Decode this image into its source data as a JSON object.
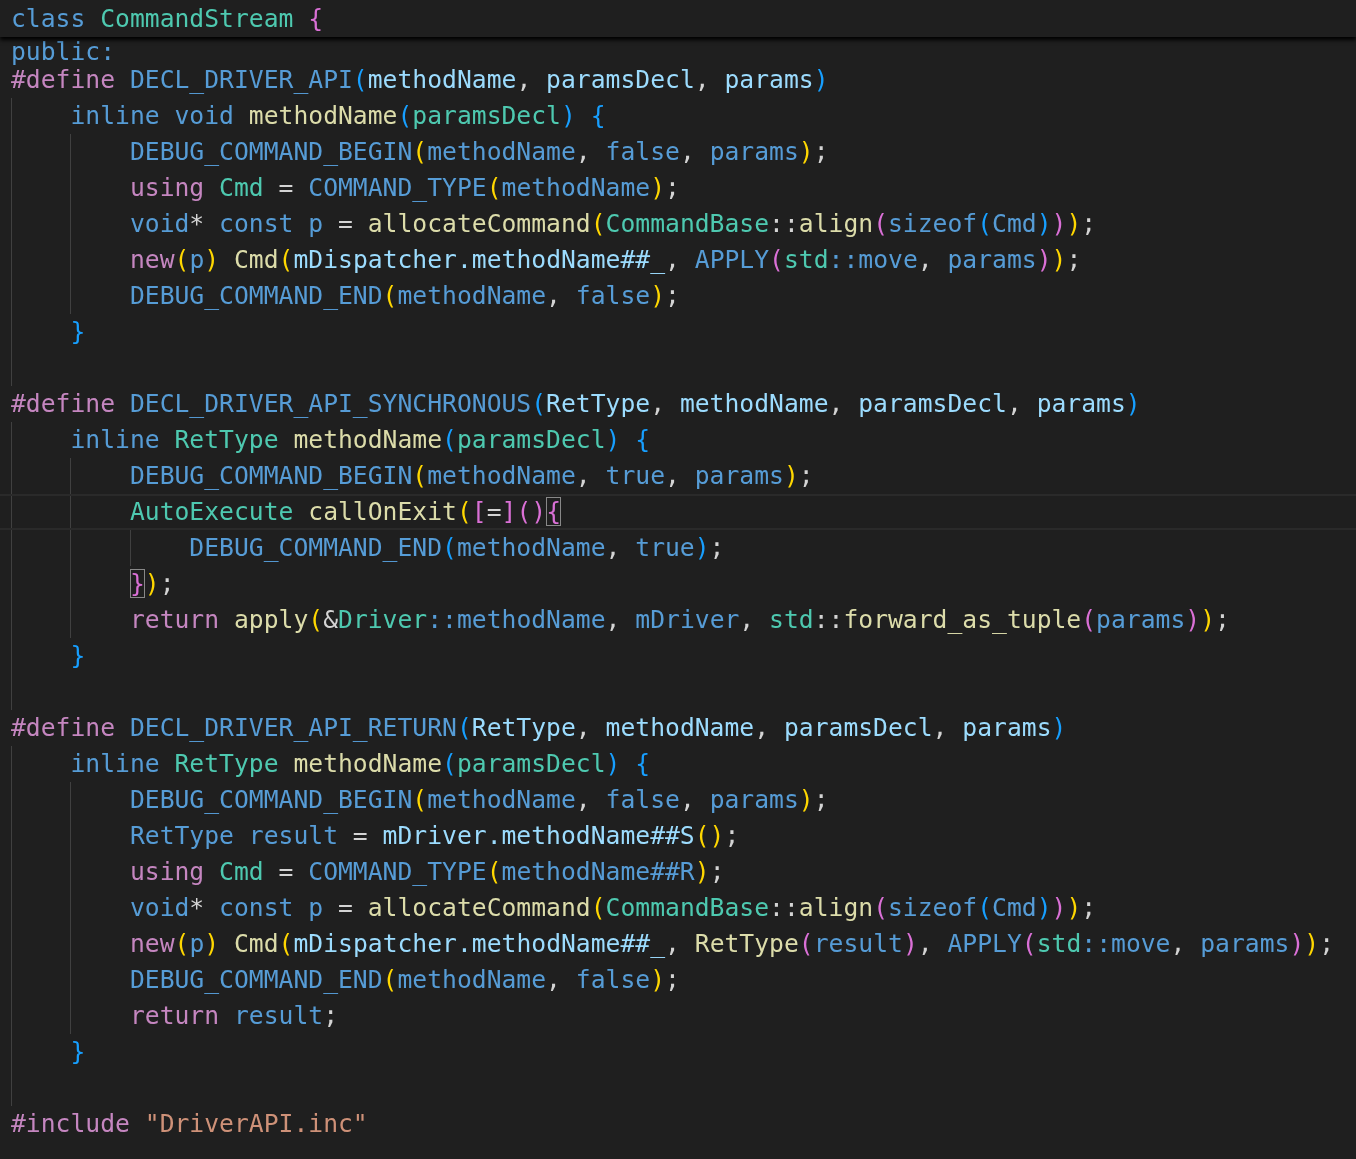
{
  "editor": {
    "sticky_line": {
      "tokens": [
        {
          "text": "class",
          "kind": "kw"
        },
        {
          "text": " CommandStream",
          "kind": "type"
        },
        {
          "text": " {",
          "kind": "b2"
        }
      ]
    },
    "partial_line": {
      "tokens": [
        {
          "text": "public:",
          "kind": "kw"
        }
      ]
    },
    "lines": [
      {
        "kind": "code",
        "tokens": [
          {
            "text": "#define",
            "kind": "ctl"
          },
          {
            "text": " DECL_DRIVER_API",
            "kind": "kw"
          },
          {
            "text": "(",
            "kind": "b3"
          },
          {
            "text": "methodName",
            "kind": "var"
          },
          {
            "text": ", ",
            "kind": "op"
          },
          {
            "text": "paramsDecl",
            "kind": "var"
          },
          {
            "text": ", ",
            "kind": "op"
          },
          {
            "text": "params",
            "kind": "var"
          },
          {
            "text": ")",
            "kind": "b3"
          }
        ]
      },
      {
        "kind": "code",
        "tokens": [
          {
            "text": "    inline void",
            "kind": "kw"
          },
          {
            "text": " methodName",
            "kind": "fn"
          },
          {
            "text": "(",
            "kind": "b3"
          },
          {
            "text": "paramsDecl",
            "kind": "type"
          },
          {
            "text": ")",
            "kind": "b3"
          },
          {
            "text": " {",
            "kind": "b3"
          }
        ]
      },
      {
        "kind": "code",
        "tokens": [
          {
            "text": "        DEBUG_COMMAND_BEGIN",
            "kind": "kw"
          },
          {
            "text": "(",
            "kind": "b1"
          },
          {
            "text": "methodName",
            "kind": "kw"
          },
          {
            "text": ", ",
            "kind": "op"
          },
          {
            "text": "false",
            "kind": "kw"
          },
          {
            "text": ", ",
            "kind": "op"
          },
          {
            "text": "params",
            "kind": "kw"
          },
          {
            "text": ")",
            "kind": "b1"
          },
          {
            "text": ";",
            "kind": "op"
          }
        ]
      },
      {
        "kind": "code",
        "tokens": [
          {
            "text": "        using",
            "kind": "ctl"
          },
          {
            "text": " Cmd",
            "kind": "type"
          },
          {
            "text": " = ",
            "kind": "op"
          },
          {
            "text": "COMMAND_TYPE",
            "kind": "kw"
          },
          {
            "text": "(",
            "kind": "b1"
          },
          {
            "text": "methodName",
            "kind": "kw"
          },
          {
            "text": ")",
            "kind": "b1"
          },
          {
            "text": ";",
            "kind": "op"
          }
        ]
      },
      {
        "kind": "code",
        "tokens": [
          {
            "text": "        void",
            "kind": "kw"
          },
          {
            "text": "* ",
            "kind": "op"
          },
          {
            "text": "const p",
            "kind": "kw"
          },
          {
            "text": " = ",
            "kind": "op"
          },
          {
            "text": "allocateCommand",
            "kind": "fn"
          },
          {
            "text": "(",
            "kind": "b1"
          },
          {
            "text": "CommandBase",
            "kind": "type"
          },
          {
            "text": "::",
            "kind": "op"
          },
          {
            "text": "align",
            "kind": "fn"
          },
          {
            "text": "(",
            "kind": "b2"
          },
          {
            "text": "sizeof",
            "kind": "kw"
          },
          {
            "text": "(",
            "kind": "b3"
          },
          {
            "text": "Cmd",
            "kind": "kw"
          },
          {
            "text": ")",
            "kind": "b3"
          },
          {
            "text": ")",
            "kind": "b2"
          },
          {
            "text": ")",
            "kind": "b1"
          },
          {
            "text": ";",
            "kind": "op"
          }
        ]
      },
      {
        "kind": "code",
        "tokens": [
          {
            "text": "        new",
            "kind": "ctl"
          },
          {
            "text": "(",
            "kind": "b1"
          },
          {
            "text": "p",
            "kind": "kw"
          },
          {
            "text": ")",
            "kind": "b1"
          },
          {
            "text": " Cmd",
            "kind": "fn"
          },
          {
            "text": "(",
            "kind": "b1"
          },
          {
            "text": "mDispatcher.methodName##_",
            "kind": "var"
          },
          {
            "text": ", ",
            "kind": "op"
          },
          {
            "text": "APPLY",
            "kind": "kw"
          },
          {
            "text": "(",
            "kind": "b2"
          },
          {
            "text": "std",
            "kind": "type"
          },
          {
            "text": "::move",
            "kind": "kw"
          },
          {
            "text": ", ",
            "kind": "op"
          },
          {
            "text": "params",
            "kind": "kw"
          },
          {
            "text": ")",
            "kind": "b2"
          },
          {
            "text": ")",
            "kind": "b1"
          },
          {
            "text": ";",
            "kind": "op"
          }
        ]
      },
      {
        "kind": "code",
        "tokens": [
          {
            "text": "        DEBUG_COMMAND_END",
            "kind": "kw"
          },
          {
            "text": "(",
            "kind": "b1"
          },
          {
            "text": "methodName",
            "kind": "kw"
          },
          {
            "text": ", ",
            "kind": "op"
          },
          {
            "text": "false",
            "kind": "kw"
          },
          {
            "text": ")",
            "kind": "b1"
          },
          {
            "text": ";",
            "kind": "op"
          }
        ]
      },
      {
        "kind": "code",
        "tokens": [
          {
            "text": "    }",
            "kind": "b3"
          }
        ]
      },
      {
        "kind": "blank"
      },
      {
        "kind": "code",
        "tokens": [
          {
            "text": "#define",
            "kind": "ctl"
          },
          {
            "text": " DECL_DRIVER_API_SYNCHRONOUS",
            "kind": "kw"
          },
          {
            "text": "(",
            "kind": "b3"
          },
          {
            "text": "RetType",
            "kind": "var"
          },
          {
            "text": ", ",
            "kind": "op"
          },
          {
            "text": "methodName",
            "kind": "var"
          },
          {
            "text": ", ",
            "kind": "op"
          },
          {
            "text": "paramsDecl",
            "kind": "var"
          },
          {
            "text": ", ",
            "kind": "op"
          },
          {
            "text": "params",
            "kind": "var"
          },
          {
            "text": ")",
            "kind": "b3"
          }
        ]
      },
      {
        "kind": "code",
        "tokens": [
          {
            "text": "    inline",
            "kind": "kw"
          },
          {
            "text": " RetType",
            "kind": "type"
          },
          {
            "text": " methodName",
            "kind": "fn"
          },
          {
            "text": "(",
            "kind": "b3"
          },
          {
            "text": "paramsDecl",
            "kind": "type"
          },
          {
            "text": ")",
            "kind": "b3"
          },
          {
            "text": " {",
            "kind": "b3"
          }
        ]
      },
      {
        "kind": "code",
        "tokens": [
          {
            "text": "        DEBUG_COMMAND_BEGIN",
            "kind": "kw"
          },
          {
            "text": "(",
            "kind": "b1"
          },
          {
            "text": "methodName",
            "kind": "kw"
          },
          {
            "text": ", ",
            "kind": "op"
          },
          {
            "text": "true",
            "kind": "kw"
          },
          {
            "text": ", ",
            "kind": "op"
          },
          {
            "text": "params",
            "kind": "kw"
          },
          {
            "text": ")",
            "kind": "b1"
          },
          {
            "text": ";",
            "kind": "op"
          }
        ]
      },
      {
        "kind": "code",
        "current": true,
        "tokens": [
          {
            "text": "        AutoExecute",
            "kind": "type"
          },
          {
            "text": " callOnExit",
            "kind": "fn"
          },
          {
            "text": "(",
            "kind": "b1"
          },
          {
            "text": "[",
            "kind": "b2"
          },
          {
            "text": "=",
            "kind": "op"
          },
          {
            "text": "]",
            "kind": "b2"
          },
          {
            "text": "(",
            "kind": "b2"
          },
          {
            "text": ")",
            "kind": "b2"
          },
          {
            "text": "{",
            "kind": "b2",
            "matched": true
          }
        ]
      },
      {
        "kind": "code",
        "tokens": [
          {
            "text": "            DEBUG_COMMAND_END",
            "kind": "kw"
          },
          {
            "text": "(",
            "kind": "b3"
          },
          {
            "text": "methodName",
            "kind": "kw"
          },
          {
            "text": ", ",
            "kind": "op"
          },
          {
            "text": "true",
            "kind": "kw"
          },
          {
            "text": ")",
            "kind": "b3"
          },
          {
            "text": ";",
            "kind": "op"
          }
        ]
      },
      {
        "kind": "code",
        "tokens": [
          {
            "text": "}",
            "kind": "b2",
            "matched": true
          },
          {
            "text": ")",
            "kind": "b1"
          },
          {
            "text": ";",
            "kind": "op"
          }
        ]
      },
      {
        "kind": "code",
        "tokens": [
          {
            "text": "        return",
            "kind": "ctl"
          },
          {
            "text": " apply",
            "kind": "fn"
          },
          {
            "text": "(",
            "kind": "b1"
          },
          {
            "text": "&",
            "kind": "op"
          },
          {
            "text": "Driver",
            "kind": "type"
          },
          {
            "text": "::methodName",
            "kind": "kw"
          },
          {
            "text": ", ",
            "kind": "op"
          },
          {
            "text": "mDriver",
            "kind": "kw"
          },
          {
            "text": ", ",
            "kind": "op"
          },
          {
            "text": "std",
            "kind": "type"
          },
          {
            "text": "::",
            "kind": "op"
          },
          {
            "text": "forward_as_tuple",
            "kind": "fn"
          },
          {
            "text": "(",
            "kind": "b2"
          },
          {
            "text": "params",
            "kind": "kw"
          },
          {
            "text": ")",
            "kind": "b2"
          },
          {
            "text": ")",
            "kind": "b1"
          },
          {
            "text": ";",
            "kind": "op"
          }
        ]
      },
      {
        "kind": "code",
        "tokens": [
          {
            "text": "    }",
            "kind": "b3"
          }
        ]
      },
      {
        "kind": "blank"
      },
      {
        "kind": "code",
        "tokens": [
          {
            "text": "#define",
            "kind": "ctl"
          },
          {
            "text": " DECL_DRIVER_API_RETURN",
            "kind": "kw"
          },
          {
            "text": "(",
            "kind": "b3"
          },
          {
            "text": "RetType",
            "kind": "var"
          },
          {
            "text": ", ",
            "kind": "op"
          },
          {
            "text": "methodName",
            "kind": "var"
          },
          {
            "text": ", ",
            "kind": "op"
          },
          {
            "text": "paramsDecl",
            "kind": "var"
          },
          {
            "text": ", ",
            "kind": "op"
          },
          {
            "text": "params",
            "kind": "var"
          },
          {
            "text": ")",
            "kind": "b3"
          }
        ]
      },
      {
        "kind": "code",
        "tokens": [
          {
            "text": "    inline",
            "kind": "kw"
          },
          {
            "text": " RetType",
            "kind": "type"
          },
          {
            "text": " methodName",
            "kind": "fn"
          },
          {
            "text": "(",
            "kind": "b3"
          },
          {
            "text": "paramsDecl",
            "kind": "type"
          },
          {
            "text": ")",
            "kind": "b3"
          },
          {
            "text": " {",
            "kind": "b3"
          }
        ]
      },
      {
        "kind": "code",
        "tokens": [
          {
            "text": "        DEBUG_COMMAND_BEGIN",
            "kind": "kw"
          },
          {
            "text": "(",
            "kind": "b1"
          },
          {
            "text": "methodName",
            "kind": "kw"
          },
          {
            "text": ", ",
            "kind": "op"
          },
          {
            "text": "false",
            "kind": "kw"
          },
          {
            "text": ", ",
            "kind": "op"
          },
          {
            "text": "params",
            "kind": "kw"
          },
          {
            "text": ")",
            "kind": "b1"
          },
          {
            "text": ";",
            "kind": "op"
          }
        ]
      },
      {
        "kind": "code",
        "tokens": [
          {
            "text": "        RetType result",
            "kind": "kw"
          },
          {
            "text": " = ",
            "kind": "op"
          },
          {
            "text": "mDriver.methodName##S",
            "kind": "var"
          },
          {
            "text": "(",
            "kind": "b1"
          },
          {
            "text": ")",
            "kind": "b1"
          },
          {
            "text": ";",
            "kind": "op"
          }
        ]
      },
      {
        "kind": "code",
        "tokens": [
          {
            "text": "        using",
            "kind": "ctl"
          },
          {
            "text": " Cmd",
            "kind": "type"
          },
          {
            "text": " = ",
            "kind": "op"
          },
          {
            "text": "COMMAND_TYPE",
            "kind": "kw"
          },
          {
            "text": "(",
            "kind": "b1"
          },
          {
            "text": "methodName##R",
            "kind": "kw"
          },
          {
            "text": ")",
            "kind": "b1"
          },
          {
            "text": ";",
            "kind": "op"
          }
        ]
      },
      {
        "kind": "code",
        "tokens": [
          {
            "text": "        void",
            "kind": "kw"
          },
          {
            "text": "* ",
            "kind": "op"
          },
          {
            "text": "const p",
            "kind": "kw"
          },
          {
            "text": " = ",
            "kind": "op"
          },
          {
            "text": "allocateCommand",
            "kind": "fn"
          },
          {
            "text": "(",
            "kind": "b1"
          },
          {
            "text": "CommandBase",
            "kind": "type"
          },
          {
            "text": "::",
            "kind": "op"
          },
          {
            "text": "align",
            "kind": "fn"
          },
          {
            "text": "(",
            "kind": "b2"
          },
          {
            "text": "sizeof",
            "kind": "kw"
          },
          {
            "text": "(",
            "kind": "b3"
          },
          {
            "text": "Cmd",
            "kind": "kw"
          },
          {
            "text": ")",
            "kind": "b3"
          },
          {
            "text": ")",
            "kind": "b2"
          },
          {
            "text": ")",
            "kind": "b1"
          },
          {
            "text": ";",
            "kind": "op"
          }
        ]
      },
      {
        "kind": "code",
        "tokens": [
          {
            "text": "        new",
            "kind": "ctl"
          },
          {
            "text": "(",
            "kind": "b1"
          },
          {
            "text": "p",
            "kind": "kw"
          },
          {
            "text": ")",
            "kind": "b1"
          },
          {
            "text": " Cmd",
            "kind": "fn"
          },
          {
            "text": "(",
            "kind": "b1"
          },
          {
            "text": "mDispatcher.methodName##_",
            "kind": "var"
          },
          {
            "text": ", ",
            "kind": "op"
          },
          {
            "text": "RetType",
            "kind": "fn"
          },
          {
            "text": "(",
            "kind": "b2"
          },
          {
            "text": "result",
            "kind": "kw"
          },
          {
            "text": ")",
            "kind": "b2"
          },
          {
            "text": ", ",
            "kind": "op"
          },
          {
            "text": "APPLY",
            "kind": "kw"
          },
          {
            "text": "(",
            "kind": "b2"
          },
          {
            "text": "std",
            "kind": "type"
          },
          {
            "text": "::move",
            "kind": "kw"
          },
          {
            "text": ", ",
            "kind": "op"
          },
          {
            "text": "params",
            "kind": "kw"
          },
          {
            "text": ")",
            "kind": "b2"
          },
          {
            "text": ")",
            "kind": "b1"
          },
          {
            "text": ";",
            "kind": "op"
          }
        ]
      },
      {
        "kind": "code",
        "tokens": [
          {
            "text": "        DEBUG_COMMAND_END",
            "kind": "kw"
          },
          {
            "text": "(",
            "kind": "b1"
          },
          {
            "text": "methodName",
            "kind": "kw"
          },
          {
            "text": ", ",
            "kind": "op"
          },
          {
            "text": "false",
            "kind": "kw"
          },
          {
            "text": ")",
            "kind": "b1"
          },
          {
            "text": ";",
            "kind": "op"
          }
        ]
      },
      {
        "kind": "code",
        "tokens": [
          {
            "text": "        return",
            "kind": "ctl"
          },
          {
            "text": " result",
            "kind": "kw"
          },
          {
            "text": ";",
            "kind": "op"
          }
        ]
      },
      {
        "kind": "code",
        "tokens": [
          {
            "text": "    }",
            "kind": "b3"
          }
        ]
      },
      {
        "kind": "blank"
      },
      {
        "kind": "code",
        "tokens": [
          {
            "text": "#include",
            "kind": "ctl"
          },
          {
            "text": " \"DriverAPI.inc\"",
            "kind": "str"
          }
        ]
      }
    ]
  }
}
